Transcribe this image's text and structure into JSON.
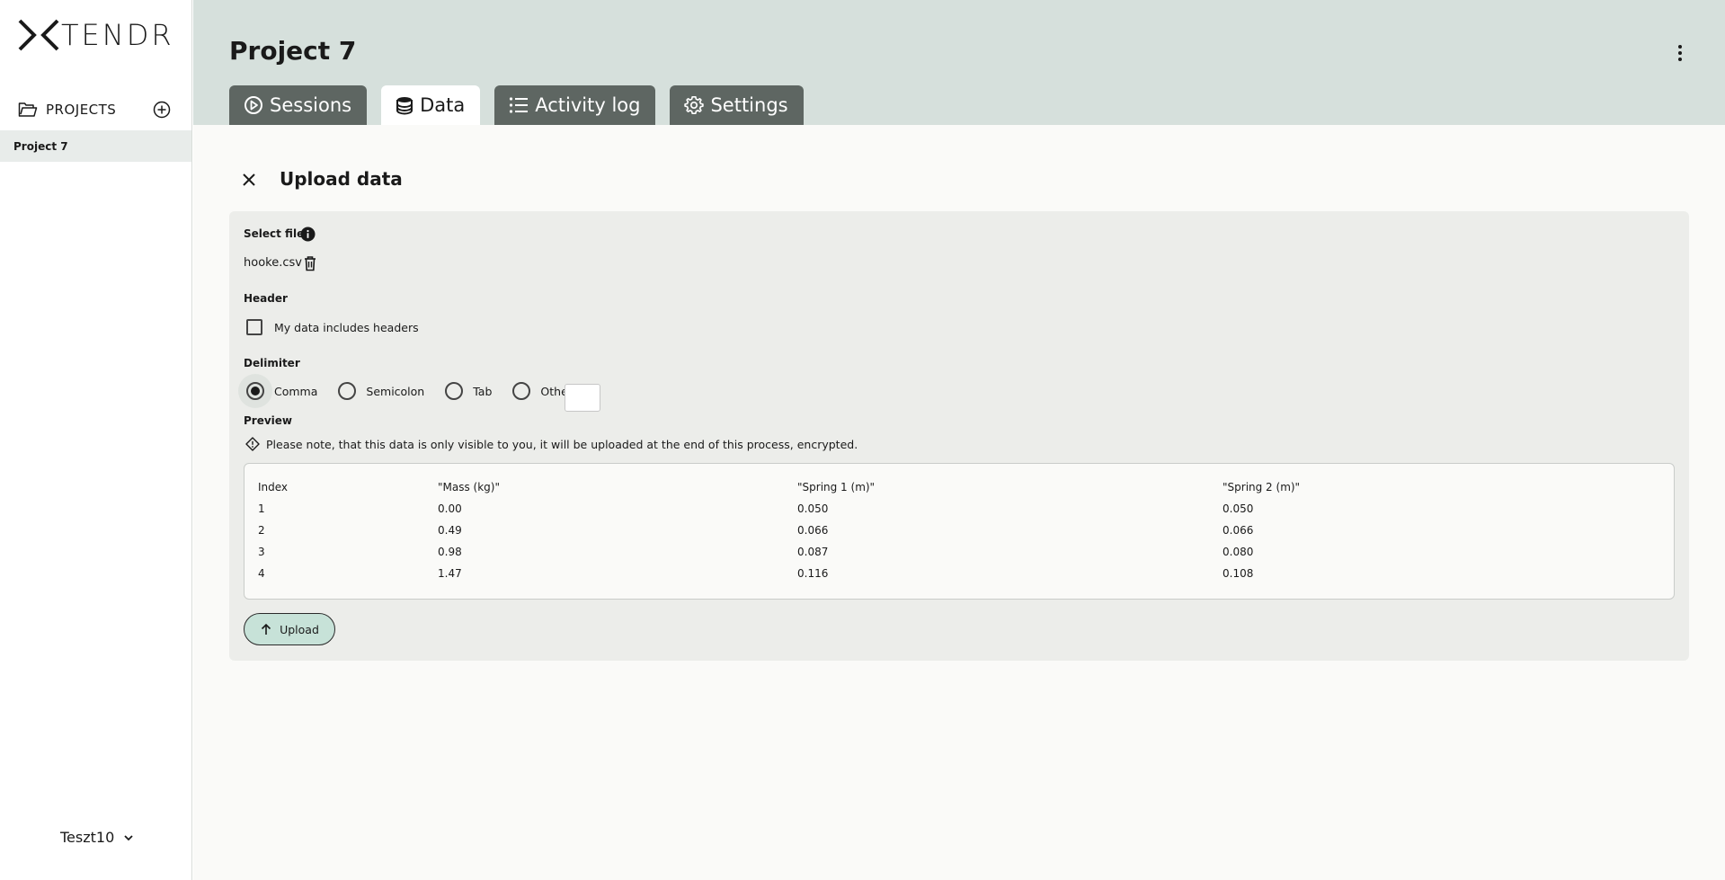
{
  "app": {
    "logo_text": "TENDR"
  },
  "sidebar": {
    "projects_label": "PROJECTS",
    "items": [
      {
        "label": "Project 7"
      }
    ],
    "user": "Teszt10"
  },
  "header": {
    "title": "Project 7",
    "tabs": [
      {
        "label": "Sessions",
        "icon": "play-circle-icon"
      },
      {
        "label": "Data",
        "icon": "database-icon",
        "active": true
      },
      {
        "label": "Activity log",
        "icon": "list-icon"
      },
      {
        "label": "Settings",
        "icon": "gear-icon"
      }
    ]
  },
  "upload": {
    "title": "Upload data",
    "select_file_label": "Select file",
    "file_name": "hooke.csv",
    "header_label": "Header",
    "header_checkbox_label": "My data includes headers",
    "delimiter_label": "Delimiter",
    "delimiters": [
      {
        "label": "Comma",
        "selected": true
      },
      {
        "label": "Semicolon",
        "selected": false
      },
      {
        "label": "Tab",
        "selected": false
      },
      {
        "label": "Other",
        "selected": false
      }
    ],
    "other_value": "",
    "preview_label": "Preview",
    "note": "Please note, that this data is only visible to you, it will be uploaded at the end of this process, encrypted.",
    "preview": {
      "columns": [
        "Index",
        "\"Mass (kg)\"",
        "\"Spring 1 (m)\"",
        "\"Spring 2 (m)\""
      ],
      "rows": [
        [
          "1",
          "0.00",
          "0.050",
          "0.050"
        ],
        [
          "2",
          "0.49",
          "0.066",
          "0.066"
        ],
        [
          "3",
          "0.98",
          "0.087",
          "0.080"
        ],
        [
          "4",
          "1.47",
          "0.116",
          "0.108"
        ]
      ]
    },
    "upload_button": "Upload"
  }
}
